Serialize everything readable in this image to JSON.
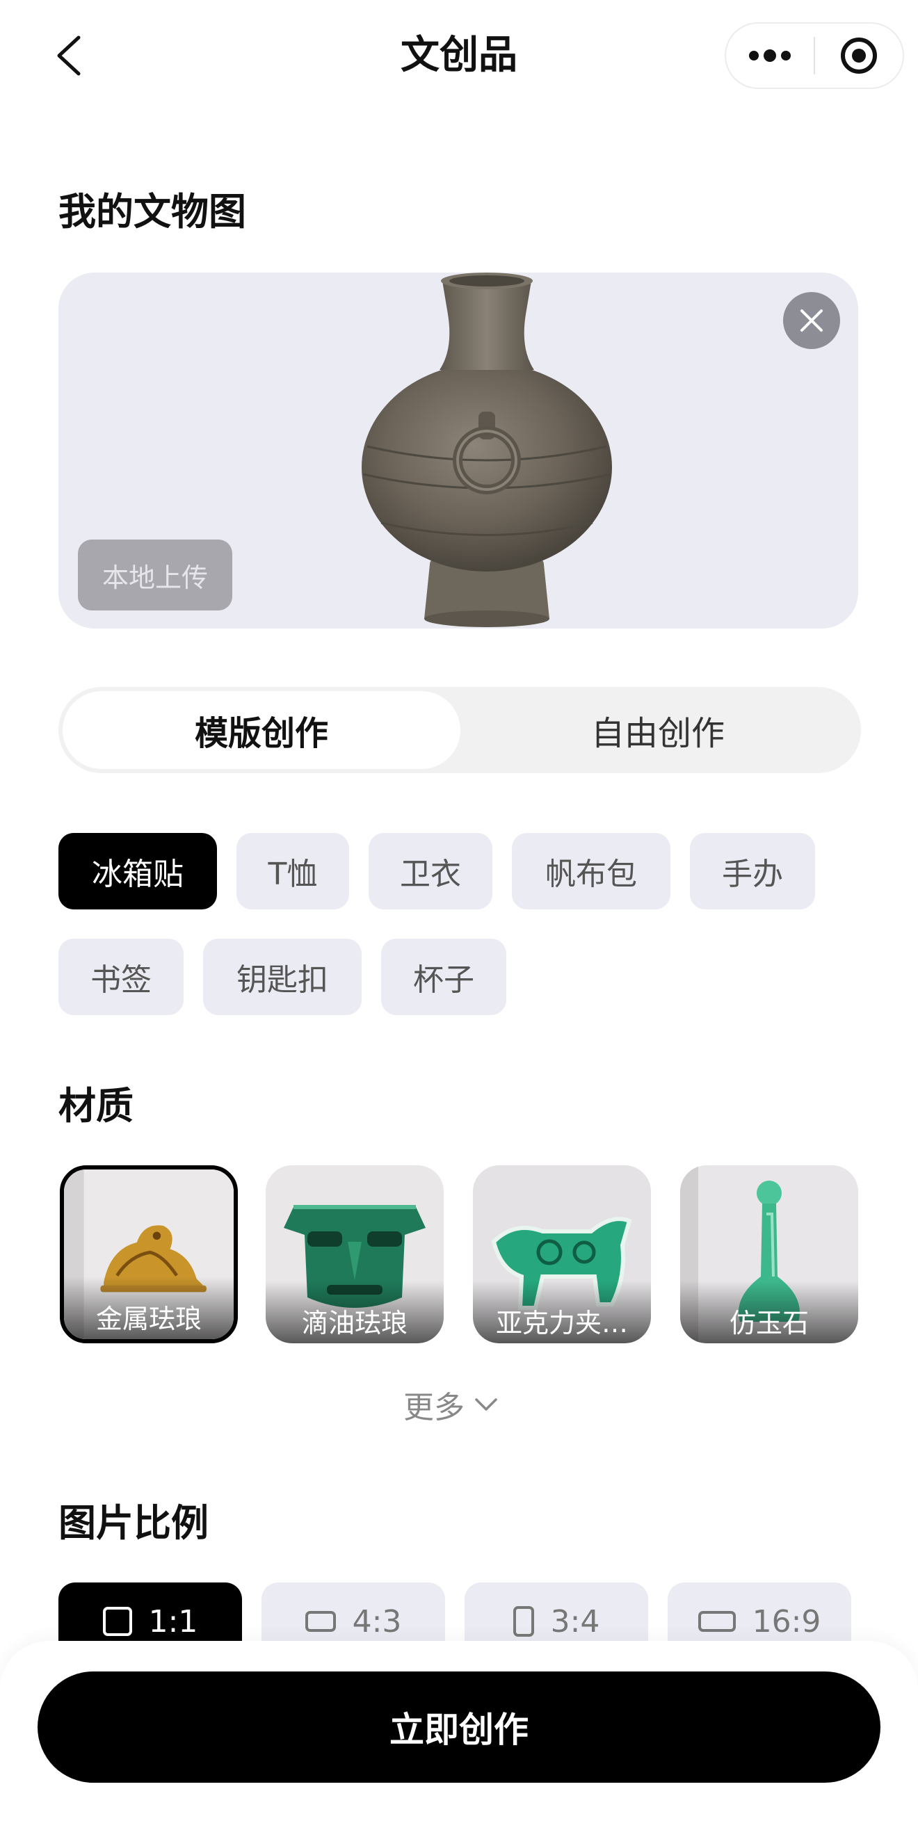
{
  "header": {
    "title": "文创品",
    "more_icon": "more-dots-icon",
    "record_icon": "record-icon",
    "back_icon": "back-arrow-icon"
  },
  "artifact_section": {
    "title": "我的文物图",
    "upload_label": "本地上传",
    "remove_icon": "close-icon"
  },
  "mode_tabs": [
    {
      "label": "模版创作",
      "active": true
    },
    {
      "label": "自由创作",
      "active": false
    }
  ],
  "product_types": [
    {
      "label": "冰箱贴",
      "selected": true
    },
    {
      "label": "T恤",
      "selected": false
    },
    {
      "label": "卫衣",
      "selected": false
    },
    {
      "label": "帆布包",
      "selected": false
    },
    {
      "label": "手办",
      "selected": false
    },
    {
      "label": "书签",
      "selected": false
    },
    {
      "label": "钥匙扣",
      "selected": false
    },
    {
      "label": "杯子",
      "selected": false
    }
  ],
  "material_section": {
    "title": "材质",
    "items": [
      {
        "label": "金属珐琅",
        "selected": true
      },
      {
        "label": "滴油珐琅",
        "selected": false
      },
      {
        "label": "亚克力夹…",
        "selected": false
      },
      {
        "label": "仿玉石",
        "selected": false
      }
    ],
    "more_label": "更多"
  },
  "ratio_section": {
    "title": "图片比例",
    "items": [
      {
        "label": "1:1",
        "selected": true
      },
      {
        "label": "4:3",
        "selected": false
      },
      {
        "label": "3:4",
        "selected": false
      },
      {
        "label": "16:9",
        "selected": false
      }
    ]
  },
  "cta": {
    "label": "立即创作"
  },
  "colors": {
    "accent": "#000000",
    "chip_bg": "#ebebf3",
    "card_bg": "#ebebf3"
  }
}
